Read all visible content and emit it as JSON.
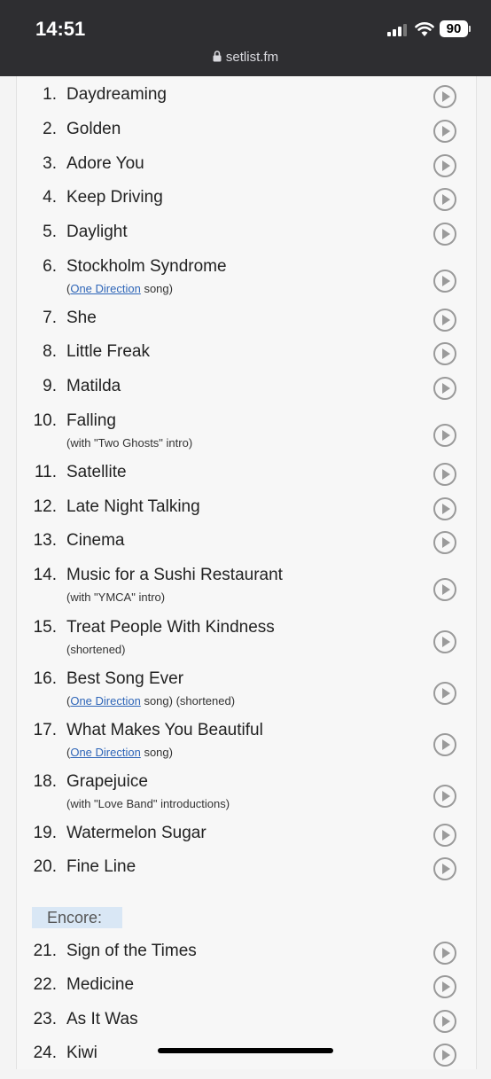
{
  "status_bar": {
    "time": "14:51",
    "battery": "90"
  },
  "browser": {
    "url": "setlist.fm"
  },
  "songs": [
    {
      "num": "1.",
      "title": "Daydreaming"
    },
    {
      "num": "2.",
      "title": "Golden"
    },
    {
      "num": "3.",
      "title": "Adore You"
    },
    {
      "num": "4.",
      "title": "Keep Driving"
    },
    {
      "num": "5.",
      "title": "Daylight"
    },
    {
      "num": "6.",
      "title": "Stockholm Syndrome",
      "note_prefix": "(",
      "note_link": "One Direction",
      "note_suffix": " song)"
    },
    {
      "num": "7.",
      "title": "She"
    },
    {
      "num": "8.",
      "title": "Little Freak"
    },
    {
      "num": "9.",
      "title": "Matilda"
    },
    {
      "num": "10.",
      "title": "Falling",
      "note_prefix": "(with \"Two Ghosts\" intro)"
    },
    {
      "num": "11.",
      "title": "Satellite"
    },
    {
      "num": "12.",
      "title": "Late Night Talking"
    },
    {
      "num": "13.",
      "title": "Cinema"
    },
    {
      "num": "14.",
      "title": "Music for a Sushi Restaurant",
      "note_prefix": "(with \"YMCA\" intro)"
    },
    {
      "num": "15.",
      "title": "Treat People With Kindness",
      "note_prefix": "(shortened)"
    },
    {
      "num": "16.",
      "title": "Best Song Ever",
      "note_prefix": "(",
      "note_link": "One Direction",
      "note_suffix": " song) (shortened)"
    },
    {
      "num": "17.",
      "title": "What Makes You Beautiful",
      "note_prefix": "(",
      "note_link": "One Direction",
      "note_suffix": " song)"
    },
    {
      "num": "18.",
      "title": "Grapejuice",
      "note_prefix": "(with \"Love Band\" introductions)"
    },
    {
      "num": "19.",
      "title": "Watermelon Sugar"
    },
    {
      "num": "20.",
      "title": "Fine Line"
    },
    {
      "num": "21.",
      "title": "Sign of the Times"
    },
    {
      "num": "22.",
      "title": "Medicine"
    },
    {
      "num": "23.",
      "title": "As It Was"
    },
    {
      "num": "24.",
      "title": "Kiwi"
    }
  ],
  "encore_label": "Encore:"
}
